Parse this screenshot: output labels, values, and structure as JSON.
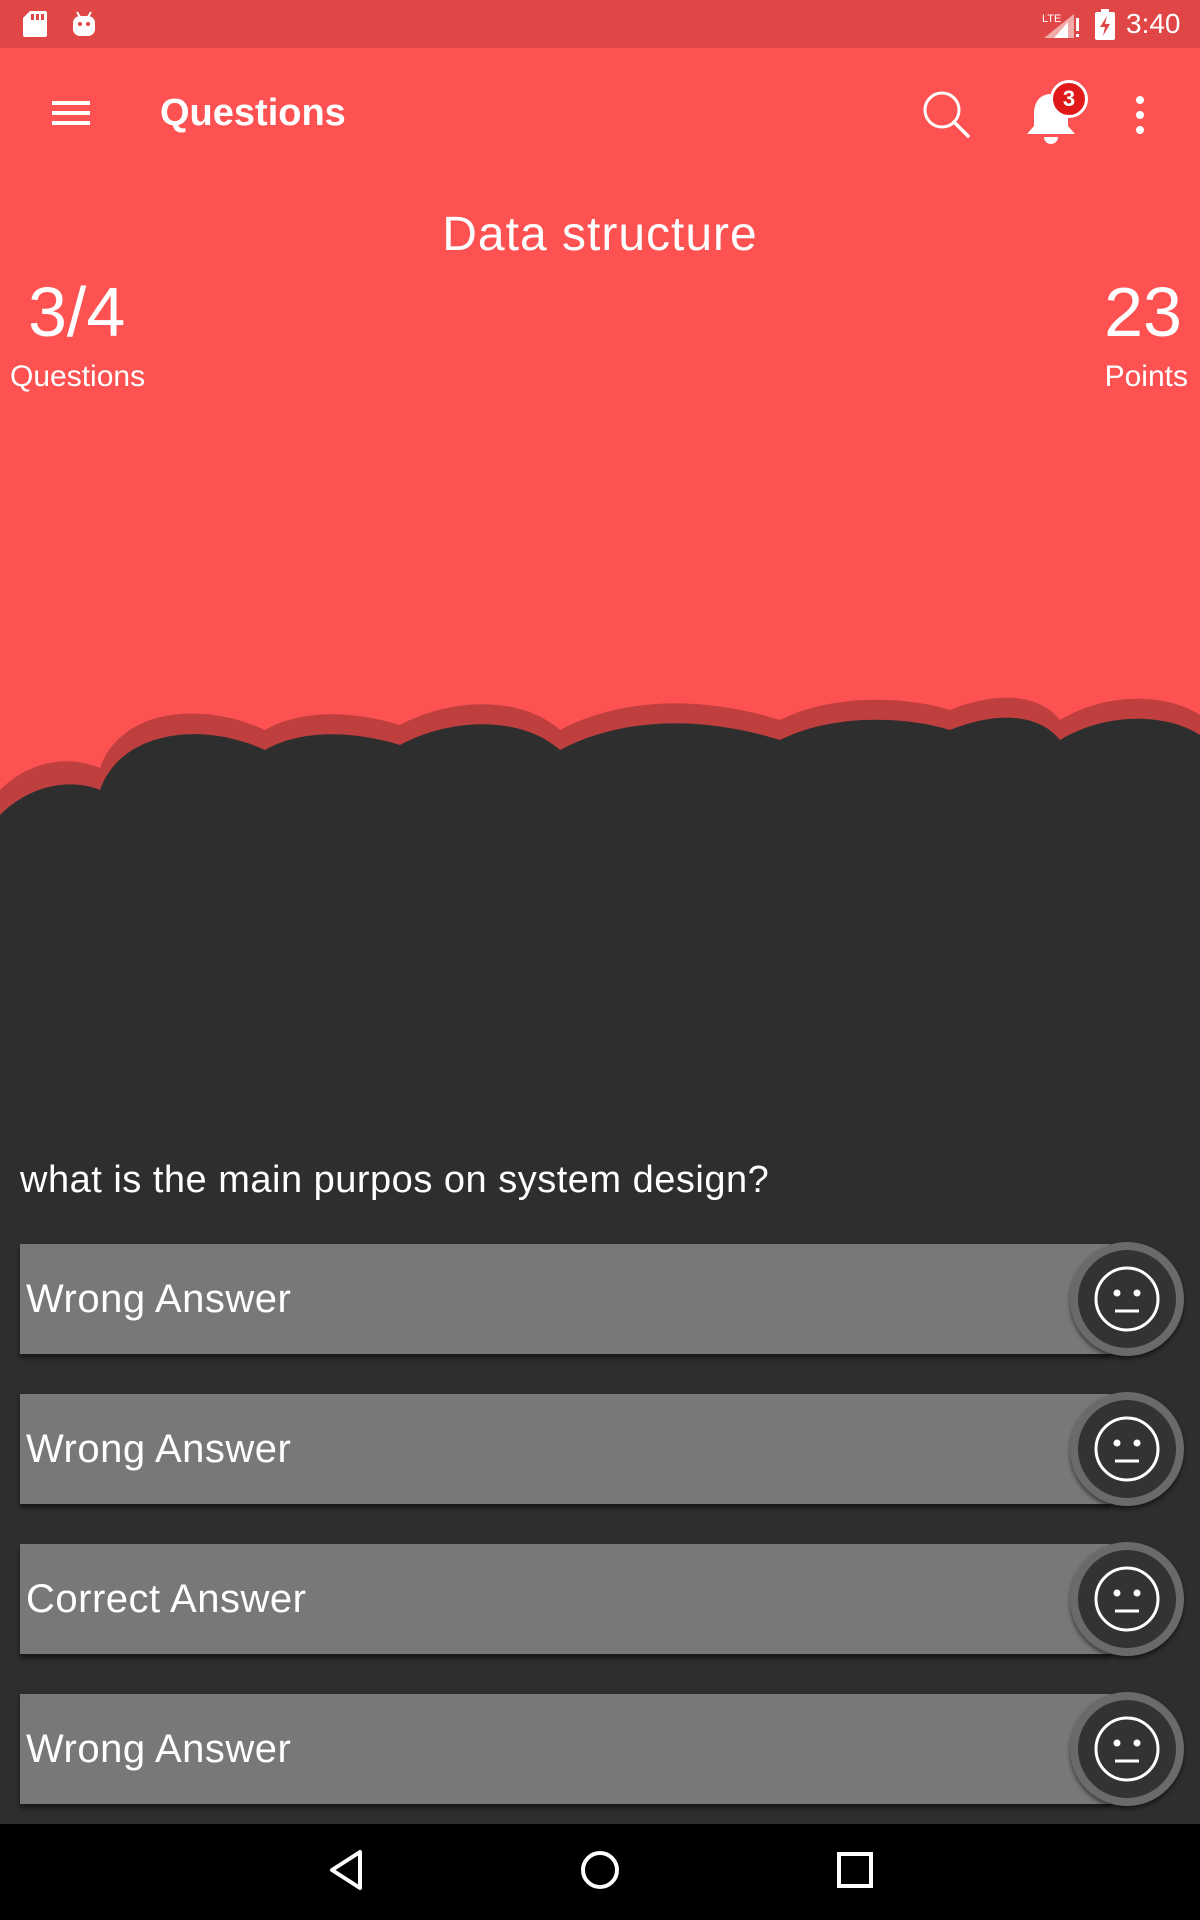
{
  "status_bar": {
    "time": "3:40",
    "network": "LTE"
  },
  "app_bar": {
    "title": "Questions",
    "notification_count": "3"
  },
  "quiz": {
    "topic": "Data structure",
    "progress": "3/4",
    "progress_label": "Questions",
    "points": "23",
    "points_label": "Points",
    "question": "what is the main purpos on system design?",
    "answers": [
      {
        "label": "Wrong Answer",
        "icon": "neutral-face-icon"
      },
      {
        "label": "Wrong Answer",
        "icon": "neutral-face-icon"
      },
      {
        "label": "Correct Answer",
        "icon": "neutral-face-icon"
      },
      {
        "label": "Wrong Answer",
        "icon": "neutral-face-icon"
      }
    ]
  },
  "colors": {
    "primary": "#fe5252",
    "status_bar": "#e04646",
    "background": "#2e2e2e",
    "answer_bar": "#787878",
    "badge": "#e01a1a"
  },
  "icons": [
    "sd-card-icon",
    "android-icon",
    "signal-icon",
    "battery-icon",
    "menu-icon",
    "search-icon",
    "bell-icon",
    "more-vert-icon",
    "back-icon",
    "home-icon",
    "recent-apps-icon"
  ]
}
